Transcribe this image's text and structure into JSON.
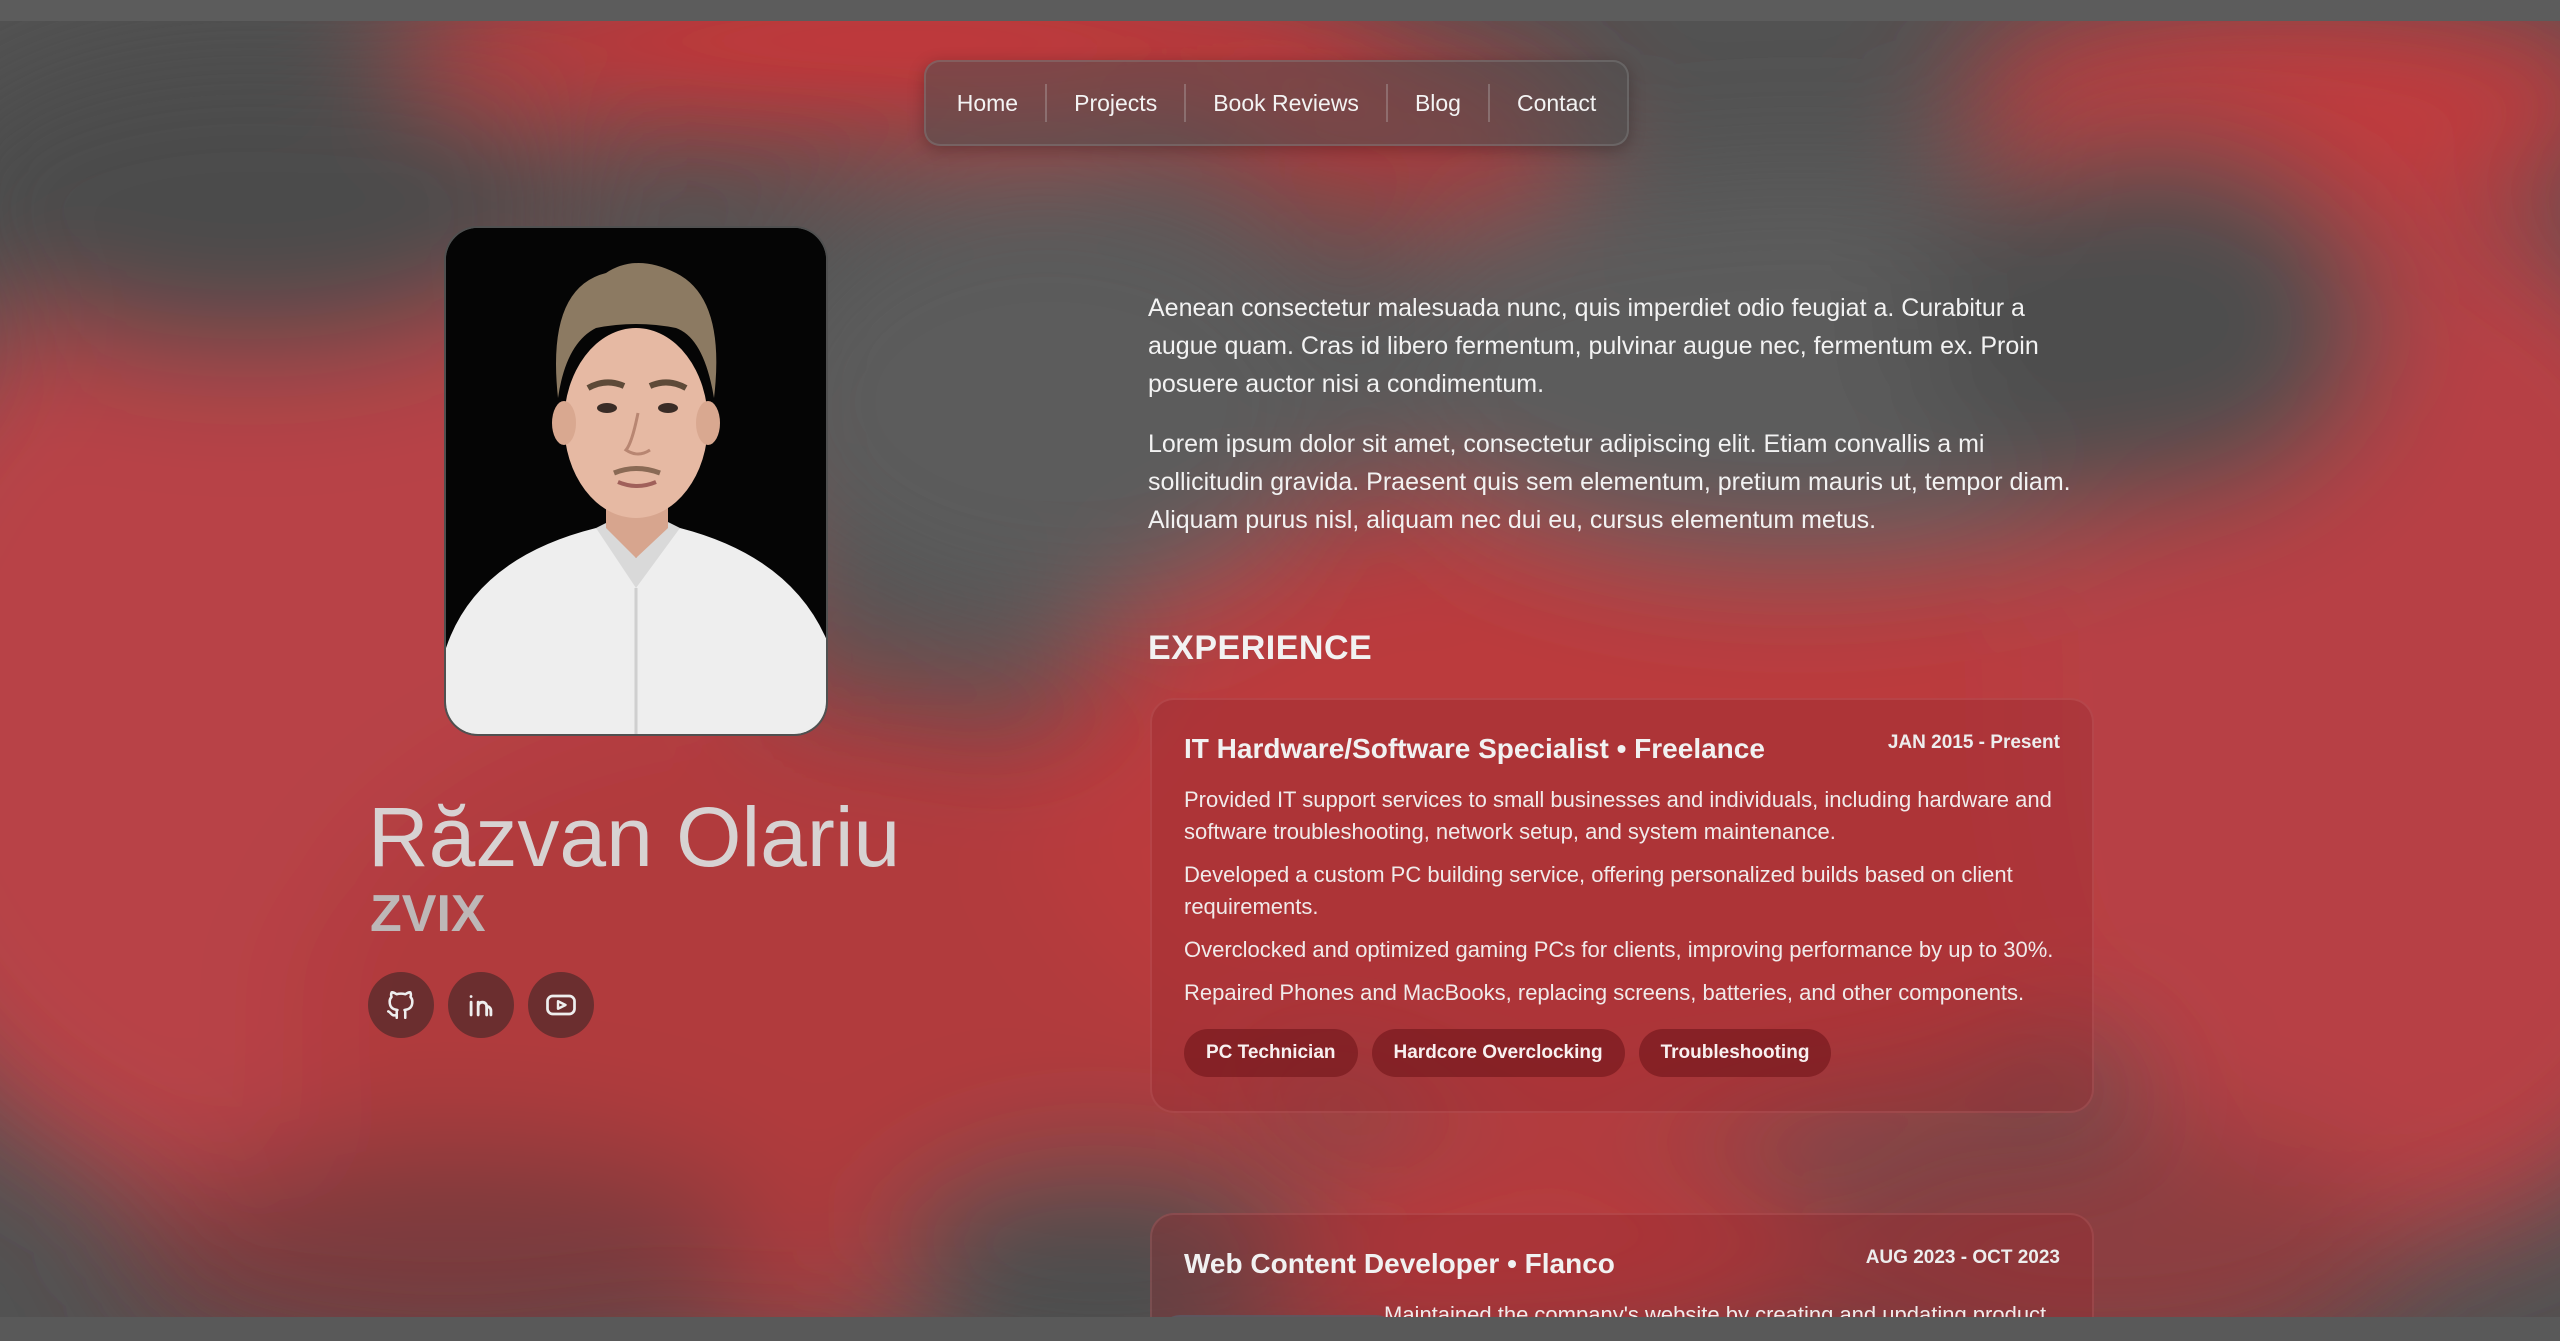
{
  "nav": {
    "items": [
      {
        "label": "Home"
      },
      {
        "label": "Projects"
      },
      {
        "label": "Book Reviews"
      },
      {
        "label": "Blog"
      },
      {
        "label": "Contact"
      }
    ]
  },
  "profile": {
    "name": "Răzvan Olariu",
    "alias": "ZVIX",
    "socials": [
      {
        "icon": "github-icon"
      },
      {
        "icon": "linkedin-icon"
      },
      {
        "icon": "youtube-icon"
      }
    ]
  },
  "about": {
    "paragraphs": [
      "Aenean consectetur malesuada nunc, quis imperdiet odio feugiat a. Curabitur a augue quam. Cras id libero fermentum, pulvinar augue nec, fermentum ex. Proin posuere auctor nisi a condimentum.",
      "Lorem ipsum dolor sit amet, consectetur adipiscing elit. Etiam convallis a mi sollicitudin gravida. Praesent quis sem elementum, pretium mauris ut, tempor diam. Aliquam purus nisl, aliquam nec dui eu, cursus elementum metus."
    ]
  },
  "experience": {
    "title": "EXPERIENCE",
    "jobs": [
      {
        "title": "IT Hardware/Software Specialist • Freelance",
        "date": "JAN 2015 - Present",
        "bullets": [
          "Provided IT support services to small businesses and individuals, including hardware and software troubleshooting, network setup, and system maintenance.",
          "Developed a custom PC building service, offering personalized builds based on client requirements.",
          "Overclocked and optimized gaming PCs for clients, improving performance by up to 30%.",
          "Repaired Phones and MacBooks, replacing screens, batteries, and other components."
        ],
        "tags": [
          "PC Technician",
          "Hardcore Overclocking",
          "Troubleshooting"
        ]
      },
      {
        "title": "Web Content Developer • Flanco",
        "date": "AUG 2023 - OCT 2023",
        "bullets": [
          "Maintained the company's website by creating and updating product"
        ]
      }
    ]
  },
  "colors": {
    "accent_red": "#c8373a",
    "gray_bg": "#4a4a4a"
  }
}
